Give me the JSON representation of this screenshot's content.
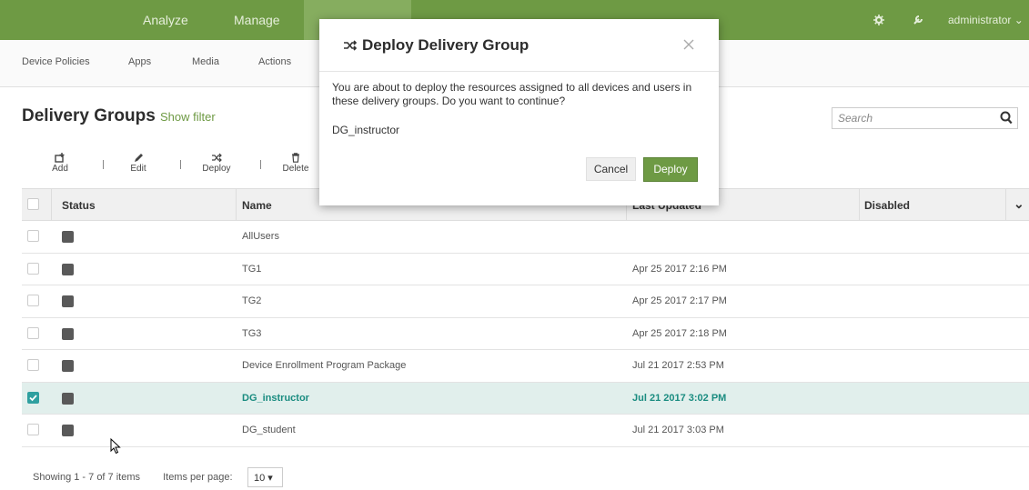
{
  "topnav": {
    "items": [
      "Analyze",
      "Manage"
    ],
    "user": "administrator"
  },
  "subnav": {
    "items": [
      "Device Policies",
      "Apps",
      "Media",
      "Actions"
    ]
  },
  "page": {
    "title": "Delivery Groups",
    "show_filter": "Show filter",
    "search_placeholder": "Search"
  },
  "toolbar": {
    "add": "Add",
    "edit": "Edit",
    "deploy": "Deploy",
    "delete": "Delete"
  },
  "table": {
    "headers": {
      "status": "Status",
      "name": "Name",
      "last_updated": "Last Updated",
      "disabled": "Disabled"
    },
    "rows": [
      {
        "name": "AllUsers",
        "updated": "",
        "checked": false
      },
      {
        "name": "TG1",
        "updated": "Apr 25 2017 2:16 PM",
        "checked": false
      },
      {
        "name": "TG2",
        "updated": "Apr 25 2017 2:17 PM",
        "checked": false
      },
      {
        "name": "TG3",
        "updated": "Apr 25 2017 2:18 PM",
        "checked": false
      },
      {
        "name": "Device Enrollment Program Package",
        "updated": "Jul 21 2017 2:53 PM",
        "checked": false
      },
      {
        "name": "DG_instructor",
        "updated": "Jul 21 2017 3:02 PM",
        "checked": true
      },
      {
        "name": "DG_student",
        "updated": "Jul 21 2017 3:03 PM",
        "checked": false
      }
    ]
  },
  "footer": {
    "showing": "Showing 1 - 7 of 7 items",
    "items_per_page_label": "Items per page:",
    "items_per_page_value": "10 ▾"
  },
  "modal": {
    "title": "Deploy Delivery Group",
    "message": "You are about to deploy the resources assigned to all devices and users in these delivery groups. Do you want to continue?",
    "item": "DG_instructor",
    "cancel": "Cancel",
    "deploy": "Deploy"
  },
  "colors": {
    "brand_green": "#6e9a44",
    "selected_teal": "#1a8c80",
    "selected_row_bg": "#e1efec"
  },
  "icons": [
    "shuffle-icon",
    "close-icon",
    "gear-icon",
    "wrench-icon",
    "chevron-down-icon",
    "search-icon",
    "add-icon",
    "edit-icon",
    "delete-icon",
    "delivery-group-icon"
  ]
}
